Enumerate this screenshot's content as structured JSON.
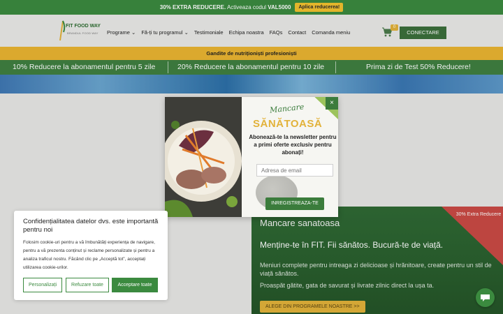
{
  "promo_bar": {
    "discount": "30% EXTRA REDUCERE.",
    "code_text": "Activeaza codul",
    "code": "VAL5000",
    "apply_label": "Aplica reducerea!"
  },
  "header": {
    "logo_name": "FIT FOOD WAY",
    "logo_tag": "BRANDUL FOOD WAY",
    "nav": [
      "Programe",
      "Fă-ți tu programul",
      "Testimoniale",
      "Echipa noastra",
      "FAQs",
      "Contact",
      "Comanda meniu"
    ],
    "cart_count": "0",
    "login_label": "CONECTARE"
  },
  "gold_bar": "Gandite de nutriționiști profesioniști",
  "discount_strip": [
    "10% Reducere la abonamentul pentru 5 zile",
    "20% Reducere la abonamentul pentru 10 zile",
    "Prima zi de Test 50% Reducere!"
  ],
  "popup": {
    "script_title": "Mancare",
    "title": "SĂNĂTOASĂ",
    "subtitle": "Abonează-te la newsletter pentru a primi oferte exclusiv pentru abonați!",
    "email_placeholder": "Adresa de email",
    "subscribe_label": "INREGISTREAZA-TE",
    "close": "×"
  },
  "hero": {
    "ribbon": "30% Extra Reducere",
    "title": "Mancare sanatoasa",
    "tagline": "Menține-te în FIT. Fii sănătos. Bucură-te de viață.",
    "desc1": "Meniuri complete pentru intreaga zi delicioase și hrănitoare, create pentru un stil de viață sănătos.",
    "desc2": "Proaspăt gătite, gata de savurat și livrate zilnic direct la ușa ta.",
    "cta": "ALEGE DIN PROGRAMELE NOASTRE >>"
  },
  "cookie": {
    "title": "Confidențialitatea datelor dvs. este importantă pentru noi",
    "text": "Folosim cookie-uri pentru a vă îmbunătăți experiența de navigare, pentru a vă prezenta conținut și reclame personalizate și pentru a analiza traficul nostru. Făcând clic pe „Acceptă tot”, acceptați utilizarea cookie-urilor.",
    "customize": "Personalizați",
    "reject": "Refuzare toate",
    "accept": "Acceptare toate"
  },
  "colors": {
    "brand_green": "#3b8a3f",
    "gold": "#e2b23a",
    "ribbon_red": "#c94a44"
  }
}
